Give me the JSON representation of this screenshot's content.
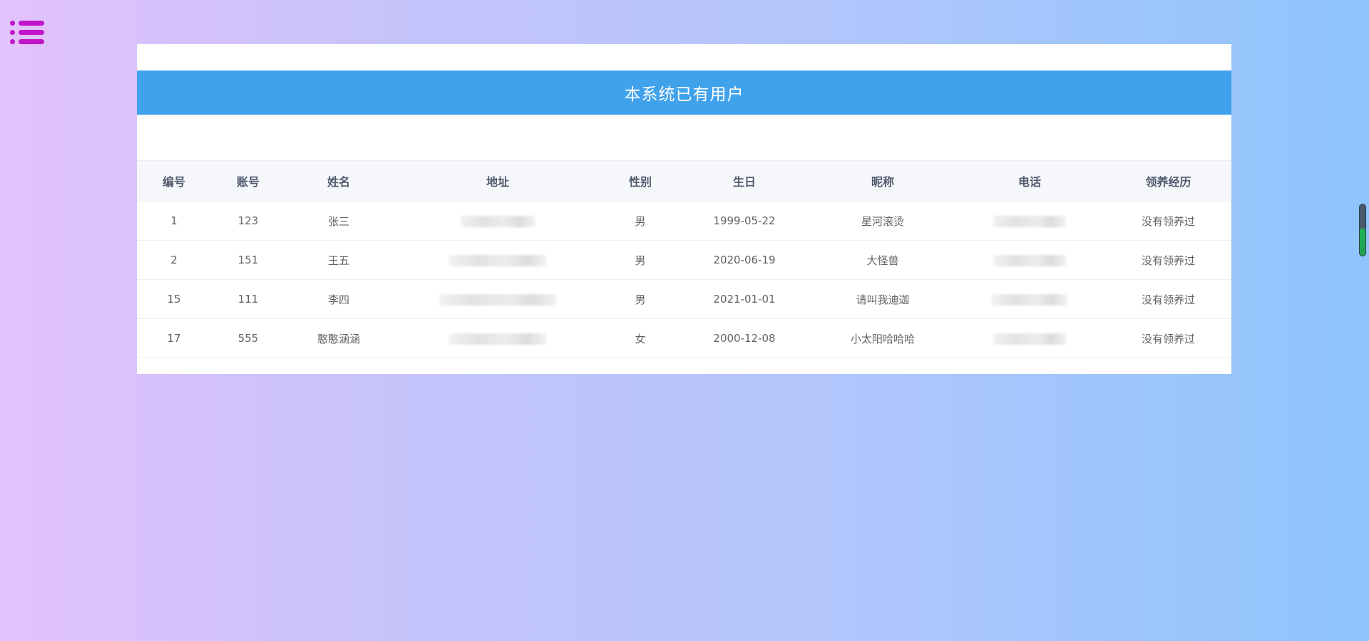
{
  "header": {
    "title": "本系统已有用户"
  },
  "table": {
    "columns": [
      "编号",
      "账号",
      "姓名",
      "地址",
      "性别",
      "生日",
      "昵称",
      "电话",
      "领养经历"
    ],
    "rows": [
      {
        "id": "1",
        "account": "123",
        "name": "张三",
        "gender": "男",
        "birthday": "1999-05-22",
        "nickname": "星河滚烫",
        "history": "没有领养过"
      },
      {
        "id": "2",
        "account": "151",
        "name": "王五",
        "gender": "男",
        "birthday": "2020-06-19",
        "nickname": "大怪兽",
        "history": "没有领养过"
      },
      {
        "id": "15",
        "account": "111",
        "name": "李四",
        "gender": "男",
        "birthday": "2021-01-01",
        "nickname": "请叫我迪迦",
        "history": "没有领养过"
      },
      {
        "id": "17",
        "account": "555",
        "name": "憨憨涵涵",
        "gender": "女",
        "birthday": "2000-12-08",
        "nickname": "小太阳哈哈哈",
        "history": "没有领养过"
      }
    ]
  },
  "icons": {
    "menu": "menu-list-icon"
  },
  "colors": {
    "header_bg": "#40a2eb",
    "menu_icon": "#c015c8"
  }
}
